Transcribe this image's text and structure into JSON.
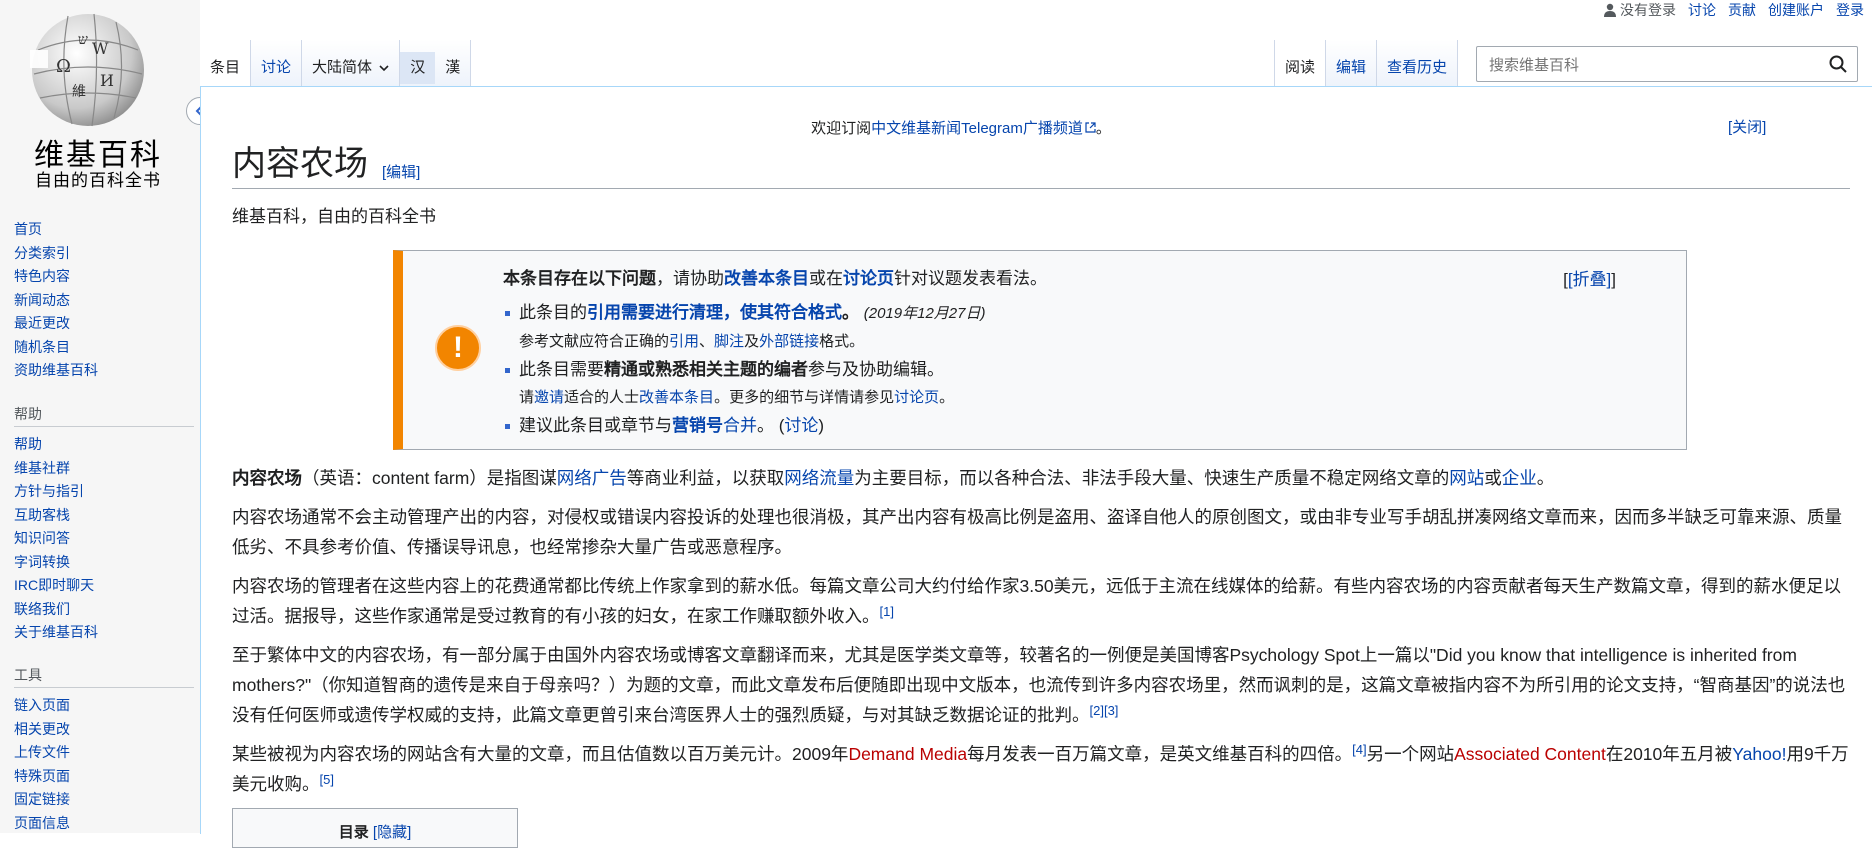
{
  "logo": {
    "name": "维基百科",
    "tagline": "自由的百科全书",
    "globe_glyphs": [
      "Ω",
      "W",
      "維",
      "И",
      "ש"
    ]
  },
  "sidebar": {
    "main": [
      "首页",
      "分类索引",
      "特色内容",
      "新闻动态",
      "最近更改",
      "随机条目",
      "资助维基百科"
    ],
    "help_heading": "帮助",
    "help": [
      "帮助",
      "维基社群",
      "方针与指引",
      "互助客栈",
      "知识问答",
      "字词转换",
      "IRC即时聊天",
      "联络我们",
      "关于维基百科"
    ],
    "tools_heading": "工具",
    "tools": [
      "链入页面",
      "相关更改",
      "上传文件",
      "特殊页面",
      "固定链接",
      "页面信息"
    ]
  },
  "personal": {
    "not_logged_in": "没有登录",
    "talk": "讨论",
    "contrib": "贡献",
    "create": "创建账户",
    "login": "登录"
  },
  "tabs": {
    "article": "条目",
    "talk": "讨论",
    "variant": "大陆简体",
    "hans": "汉",
    "hant": "漢",
    "read": "阅读",
    "edit": "编辑",
    "history": "查看历史"
  },
  "search": {
    "placeholder": "搜索维基百科"
  },
  "notice": {
    "pre": "欢迎订阅",
    "link": "中文维基新闻Telegram广播频道",
    "post": "。",
    "close": "[关闭]"
  },
  "page": {
    "title": "内容农场",
    "edit": "[编辑]",
    "tagline": "维基百科，自由的百科全书"
  },
  "ambox": {
    "head_bold": "本条目存在以下问题",
    "head_1": "，请协助",
    "head_link_1": "改善本条目",
    "head_2": "或在",
    "head_link_2": "讨论页",
    "head_3": "针对议题发表看法。",
    "collapse": "[折叠]",
    "i1_pre": "此条目的",
    "i1_link": "引用需要进行清理，使其符合格式",
    "i1_post": "。",
    "i1_date": "(2019年12月27日)",
    "i1_sub_pre": "参考文献应符合正确的",
    "i1_sub_l1": "引用",
    "i1_sub_s1": "、",
    "i1_sub_l2": "脚注",
    "i1_sub_s2": "及",
    "i1_sub_l3": "外部链接",
    "i1_sub_post": "格式。",
    "i2_pre": "此条目需要",
    "i2_bold": "精通或熟悉相关主题的编者",
    "i2_post": "参与及协助编辑。",
    "i2_sub_pre": "请",
    "i2_sub_l1": "邀请",
    "i2_sub_mid": "适合的人士",
    "i2_sub_l2": "改善本条目",
    "i2_sub_mid2": "。更多的细节与详情请参见",
    "i2_sub_l3": "讨论页",
    "i2_sub_post": "。",
    "i3_pre": "建议此条目或章节与",
    "i3_link": "营销号",
    "i3_merge": "合并",
    "i3_mid": "。  (",
    "i3_talk": "讨论",
    "i3_post": ")"
  },
  "body": {
    "p1": {
      "bold": "内容农场",
      "a": "（英语：content farm）是指图谋",
      "l1": "网络广告",
      "b": "等商业利益，以获取",
      "l2": "网络流量",
      "c": "为主要目标，而以各种合法、非法手段大量、快速生产质量不稳定网络文章的",
      "l3": "网站",
      "d": "或",
      "l4": "企业",
      "e": "。"
    },
    "p2": "内容农场通常不会主动管理产出的内容，对侵权或错误内容投诉的处理也很消极，其产出内容有极高比例是盗用、盗译自他人的原创图文，或由非专业写手胡乱拼凑网络文章而来，因而多半缺乏可靠来源、质量低劣、不具参考价值、传播误导讯息，也经常掺杂大量广告或恶意程序。",
    "p3": {
      "text": "内容农场的管理者在这些内容上的花费通常都比传统上作家拿到的薪水低。每篇文章公司大约付给作家3.50美元，远低于主流在线媒体的给薪。有些内容农场的内容贡献者每天生产数篇文章，得到的薪水便足以过活。据报导，这些作家通常是受过教育的有小孩的妇女，在家工作赚取额外收入。",
      "ref": "[1]"
    },
    "p4": {
      "text": "至于繁体中文的内容农场，有一部分属于由国外内容农场或博客文章翻译而来，尤其是医学类文章等，较著名的一例便是美国博客Psychology Spot上一篇以\"Did you know that intelligence is inherited from mothers?\"（你知道智商的遗传是来自于母亲吗？）为题的文章，而此文章发布后便随即出现中文版本，也流传到许多内容农场里，然而讽刺的是，这篇文章被指内容不为所引用的论文支持，“智商基因”的说法也没有任何医师或遗传学权威的支持，此篇文章更曾引来台湾医界人士的强烈质疑，与对其缺乏数据论证的批判。",
      "ref1": "[2]",
      "ref2": "[3]"
    },
    "p5": {
      "a": "某些被视为内容农场的网站含有大量的文章，而且估值数以百万美元计。2009年",
      "l1": "Demand Media",
      "b": "每月发表一百万篇文章，是英文维基百科的四倍。",
      "ref1": "[4]",
      "c": "另一个网站",
      "l2": "Associated Content",
      "d": "在2010年五月被",
      "l3": "Yahoo!",
      "e": "用9千万美元收购。",
      "ref2": "[5]"
    }
  },
  "toc": {
    "title": "目录",
    "toggle": "[隐藏]"
  }
}
